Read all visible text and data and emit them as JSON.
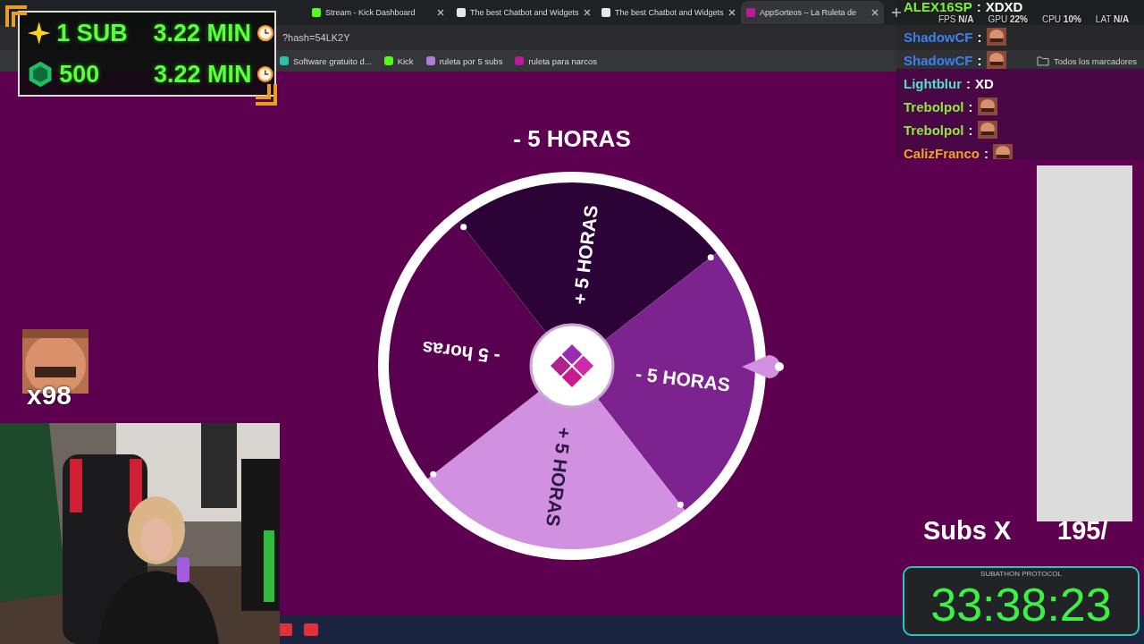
{
  "browser": {
    "tabs": [
      {
        "title": "Stream - Kick Dashboard",
        "selected": false
      },
      {
        "title": "The best Chatbot and Widgets",
        "selected": false
      },
      {
        "title": "The best Chatbot and Widgets",
        "selected": false
      },
      {
        "title": "AppSorteos – La Ruleta de",
        "selected": true
      }
    ],
    "address": "?hash=54LK2Y",
    "bookmarks": [
      {
        "label": "Software gratuito d...",
        "color": "#27c4b0"
      },
      {
        "label": "Kick",
        "color": "#53fc18"
      },
      {
        "label": "ruleta por 5 subs",
        "color": "#b07cd8"
      },
      {
        "label": "ruleta para narcos",
        "color": "#c0189a"
      }
    ],
    "bookmarks_folder": "Todos los marcadores"
  },
  "page": {
    "result": "- 5 HORAS",
    "wheel": {
      "segments": [
        {
          "label": "+ 5 HORAS",
          "color": "#2c0336"
        },
        {
          "label": "- 5 HORAS",
          "color": "#7c2390"
        },
        {
          "label": "+ 5 HORAS",
          "color": "#d291e0"
        },
        {
          "label": "- 5 horas",
          "color": "#5a0050"
        }
      ]
    }
  },
  "goals": [
    {
      "kind": "sub",
      "amount": "1 SUB",
      "time": "3.22 MIN"
    },
    {
      "kind": "kicks",
      "amount": "500",
      "time": "3.22 MIN"
    }
  ],
  "stats": [
    {
      "label": "FPS",
      "value": "N/A"
    },
    {
      "label": "GPU",
      "value": "22%"
    },
    {
      "label": "CPU",
      "value": "10%"
    },
    {
      "label": "LAT",
      "value": "N/A"
    }
  ],
  "chat": [
    {
      "name": "ALEX16SP",
      "color": "#7cf03c",
      "separator": ":",
      "kind": "text",
      "message": "XDXD"
    },
    {
      "name": "ShadowCF",
      "color": "#3d7ff0",
      "separator": ":",
      "kind": "emote"
    },
    {
      "name": "ShadowCF",
      "color": "#3d7ff0",
      "separator": ":",
      "kind": "emote"
    },
    {
      "name": "Lightblur",
      "color": "#4fe0c8",
      "separator": ":",
      "kind": "text",
      "message": "XD"
    },
    {
      "name": "Trebolpol",
      "color": "#8ee63c",
      "separator": ":",
      "kind": "emote"
    },
    {
      "name": "Trebolpol",
      "color": "#8ee63c",
      "separator": ":",
      "kind": "emote"
    },
    {
      "name": "CalizFranco",
      "color": "#f0a224",
      "separator": ":",
      "kind": "emote"
    }
  ],
  "emote_combo": {
    "count": "x98"
  },
  "subs_counter": {
    "label": "Subs X",
    "value": "195/"
  },
  "subathon": {
    "title": "SUBATHON PROTOCOL",
    "time": "33:38:23"
  }
}
